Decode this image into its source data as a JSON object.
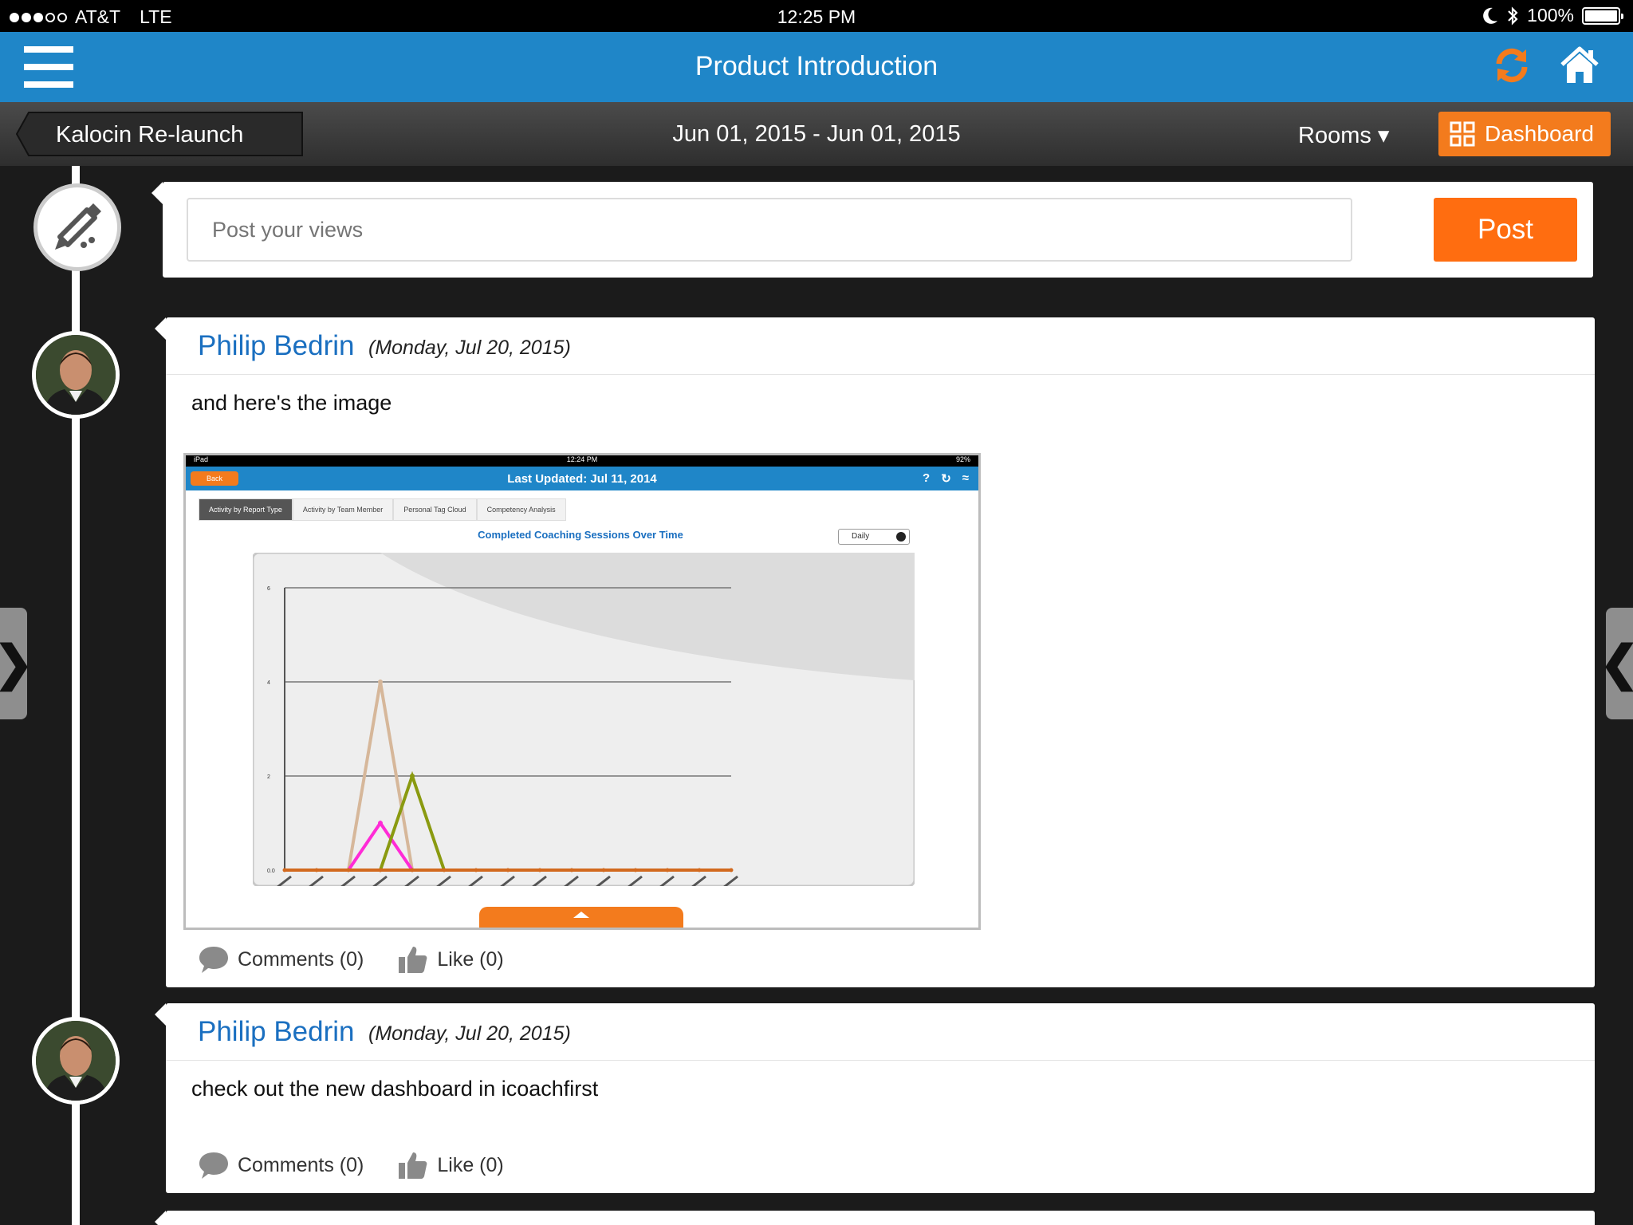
{
  "status_bar": {
    "carrier": "AT&T",
    "network": "LTE",
    "time": "12:25 PM",
    "battery": "100%"
  },
  "header": {
    "title": "Product Introduction"
  },
  "subbar": {
    "back_label": "Kalocin Re-launch",
    "date_range": "Jun 01, 2015 - Jun 01, 2015",
    "rooms_label": "Rooms ▾",
    "dashboard_label": "Dashboard"
  },
  "composer": {
    "placeholder": "Post your views",
    "post_label": "Post"
  },
  "posts": [
    {
      "author": "Philip Bedrin",
      "date": "(Monday, Jul 20, 2015)",
      "text": "and here's the image",
      "comments": "Comments (0)",
      "likes": "Like (0)",
      "image": {
        "status_left": "iPad",
        "status_time": "12:24 PM",
        "status_right": "92%",
        "back_label": "Back",
        "title": "Last Updated: Jul 11, 2014",
        "tabs": [
          "Activity by Report Type",
          "Activity by Team Member",
          "Personal Tag Cloud",
          "Competency Analysis"
        ],
        "chart_title": "Completed Coaching Sessions Over Time",
        "period": "Daily"
      }
    },
    {
      "author": "Philip Bedrin",
      "date": "(Monday, Jul 20, 2015)",
      "text": "check out the new dashboard in icoachfirst",
      "comments": "Comments (0)",
      "likes": "Like (0)"
    }
  ],
  "chart_data": {
    "type": "line",
    "title": "Completed Coaching Sessions Over Time",
    "ylim": [
      0,
      6
    ],
    "y_ticks": [
      "6",
      "4",
      "2",
      "0.0"
    ],
    "x": [
      1,
      2,
      3,
      4,
      5,
      6,
      7,
      8,
      9,
      10,
      11,
      12,
      13,
      14,
      15
    ],
    "series": [
      {
        "color": "#d6b79a",
        "values": [
          0,
          0,
          0,
          4,
          0,
          0,
          0,
          0,
          0,
          0,
          0,
          0,
          0,
          0,
          0
        ]
      },
      {
        "color": "#ff2bd6",
        "values": [
          0,
          0,
          0,
          1,
          0,
          0,
          0,
          0,
          0,
          0,
          0,
          0,
          0,
          0,
          0
        ]
      },
      {
        "color": "#8a9a10",
        "values": [
          0,
          0,
          0,
          0,
          2,
          0,
          0,
          0,
          0,
          0,
          0,
          0,
          0,
          0,
          0
        ]
      },
      {
        "color": "#d2691e",
        "values": [
          0,
          0,
          0,
          0,
          0,
          0,
          0,
          0,
          0,
          0,
          0,
          0,
          0,
          0,
          0
        ]
      }
    ],
    "grid": true
  },
  "colors": {
    "header_blue": "#1f86c8",
    "accent_orange": "#ff6d10",
    "author_blue": "#1a6fc0"
  },
  "icons": [
    "menu-icon",
    "refresh-icon",
    "home-icon",
    "dashboard-grid-icon",
    "compose-pencil-icon",
    "comment-icon",
    "like-icon"
  ]
}
